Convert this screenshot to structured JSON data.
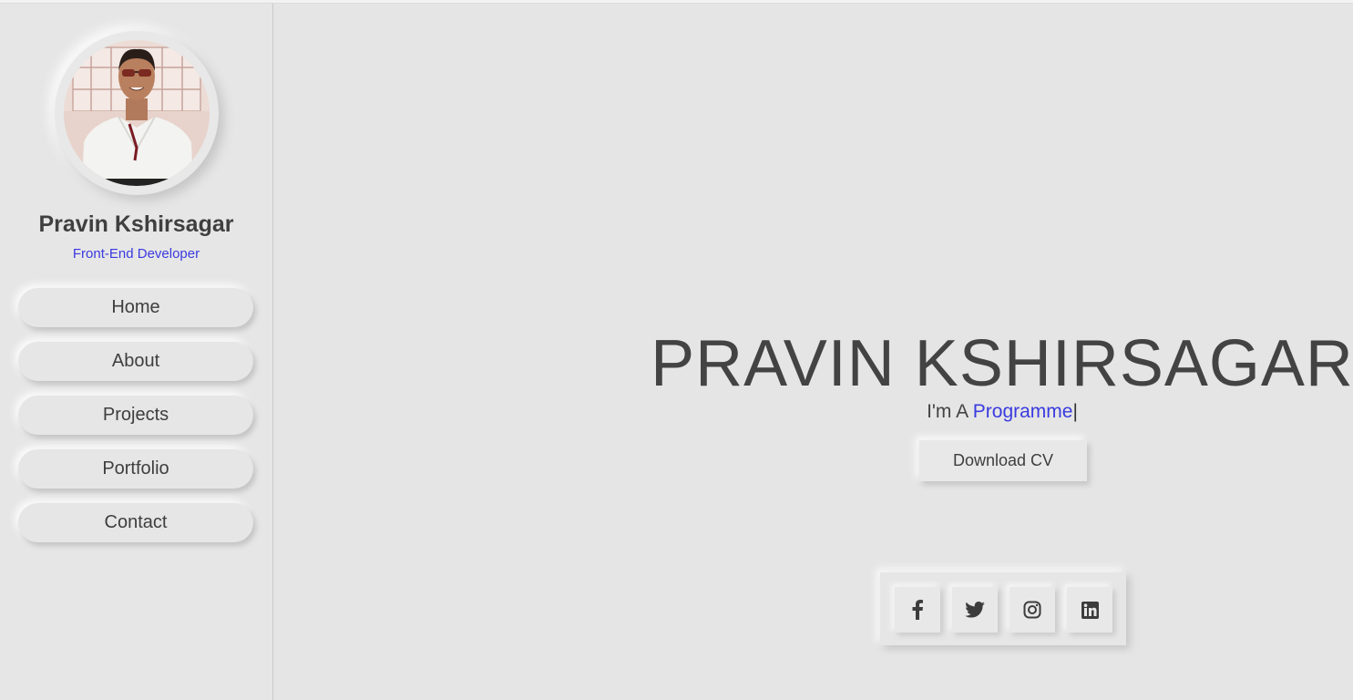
{
  "sidebar": {
    "name": "Pravin Kshirsagar",
    "role": "Front-End Developer",
    "nav": [
      {
        "label": "Home"
      },
      {
        "label": "About"
      },
      {
        "label": "Projects"
      },
      {
        "label": "Portfolio"
      },
      {
        "label": "Contact"
      }
    ]
  },
  "hero": {
    "name": "PRAVIN KSHIRSAGAR",
    "prefix": "I'm A ",
    "typed": "Programme",
    "cursor": "|",
    "cv_label": "Download CV"
  },
  "social": [
    {
      "icon": "facebook-icon"
    },
    {
      "icon": "twitter-icon"
    },
    {
      "icon": "instagram-icon"
    },
    {
      "icon": "linkedin-icon"
    }
  ],
  "colors": {
    "background": "#e5e5e5",
    "accent": "#3a3ae0",
    "text": "#444444"
  }
}
